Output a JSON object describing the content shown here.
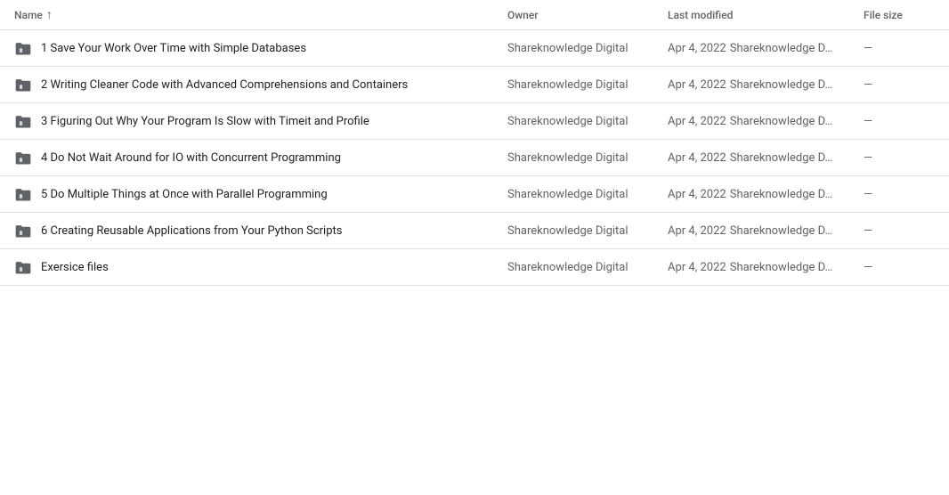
{
  "header": {
    "name_label": "Name",
    "sort_arrow": "↑",
    "owner_label": "Owner",
    "modified_label": "Last modified",
    "filesize_label": "File size"
  },
  "rows": [
    {
      "id": 1,
      "name": "1 Save Your Work Over Time with Simple Databases",
      "owner": "Shareknowledge Digital",
      "modified_date": "Apr 4, 2022",
      "modified_person": "Shareknowledge D…",
      "filesize": "—"
    },
    {
      "id": 2,
      "name": "2 Writing Cleaner Code with Advanced Comprehensions and Containers",
      "owner": "Shareknowledge Digital",
      "modified_date": "Apr 4, 2022",
      "modified_person": "Shareknowledge D…",
      "filesize": "—"
    },
    {
      "id": 3,
      "name": "3 Figuring Out Why Your Program Is Slow with Timeit and Profile",
      "owner": "Shareknowledge Digital",
      "modified_date": "Apr 4, 2022",
      "modified_person": "Shareknowledge D…",
      "filesize": "—"
    },
    {
      "id": 4,
      "name": "4 Do Not Wait Around for IO with Concurrent Programming",
      "owner": "Shareknowledge Digital",
      "modified_date": "Apr 4, 2022",
      "modified_person": "Shareknowledge D…",
      "filesize": "—"
    },
    {
      "id": 5,
      "name": "5 Do Multiple Things at Once with Parallel Programming",
      "owner": "Shareknowledge Digital",
      "modified_date": "Apr 4, 2022",
      "modified_person": "Shareknowledge D…",
      "filesize": "—"
    },
    {
      "id": 6,
      "name": "6 Creating Reusable Applications from Your Python Scripts",
      "owner": "Shareknowledge Digital",
      "modified_date": "Apr 4, 2022",
      "modified_person": "Shareknowledge D…",
      "filesize": "—"
    },
    {
      "id": 7,
      "name": "Exersice files",
      "owner": "Shareknowledge Digital",
      "modified_date": "Apr 4, 2022",
      "modified_person": "Shareknowledge D…",
      "filesize": "—"
    }
  ]
}
